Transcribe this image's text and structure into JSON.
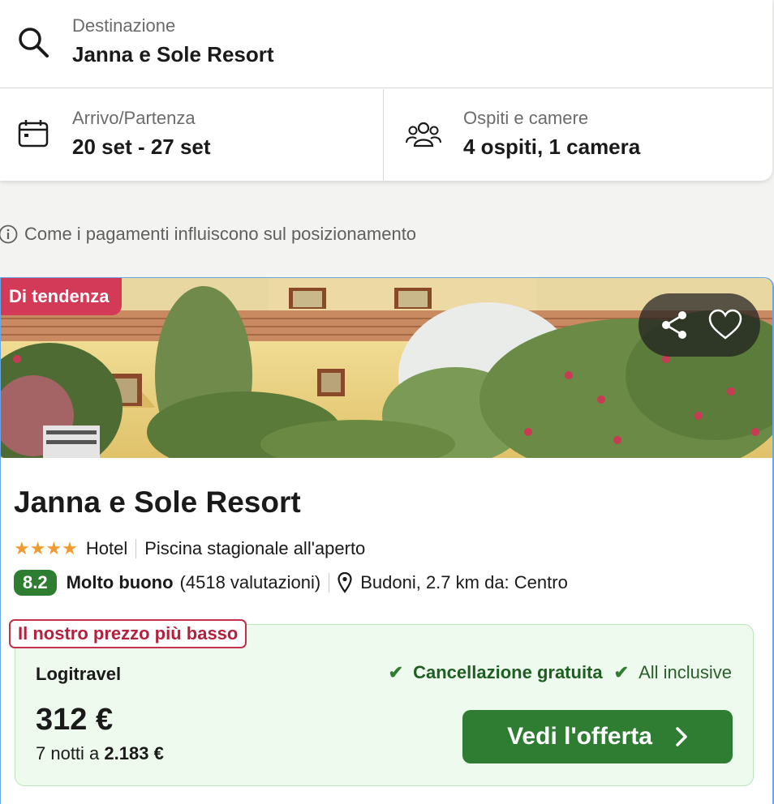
{
  "search": {
    "destination": {
      "label": "Destinazione",
      "value": "Janna e Sole Resort",
      "icon": "search-icon"
    },
    "dates": {
      "label": "Arrivo/Partenza",
      "value": "20 set - 27 set",
      "icon": "calendar-icon"
    },
    "guests": {
      "label": "Ospiti e camere",
      "value": "4 ospiti, 1 camera",
      "icon": "people-icon"
    }
  },
  "payment_info": {
    "text": "Come i pagamenti influiscono sul posizionamento",
    "icon": "info-icon"
  },
  "hotel": {
    "badge": "Di tendenza",
    "name": "Janna e Sole Resort",
    "stars": "★★★★",
    "star_count": 4,
    "type": "Hotel",
    "amenity": "Piscina stagionale all'aperto",
    "score": "8.2",
    "score_word": "Molto buono",
    "reviews": "(4518 valutazioni)",
    "location": "Budoni, 2.7 km da: Centro"
  },
  "deal": {
    "tag": "Il nostro prezzo più basso",
    "provider": "Logitravel",
    "perk_free_cancel": "Cancellazione gratuita",
    "perk_all_inclusive": "All inclusive",
    "price": "312 €",
    "total_prefix": "7 notti a",
    "total_value": "2.183 €",
    "cta": "Vedi l'offerta"
  },
  "colors": {
    "accent_green": "#2e7d32",
    "badge_red": "#d33a58",
    "score_green": "#2f7d31",
    "star_orange": "#f29a2e"
  }
}
